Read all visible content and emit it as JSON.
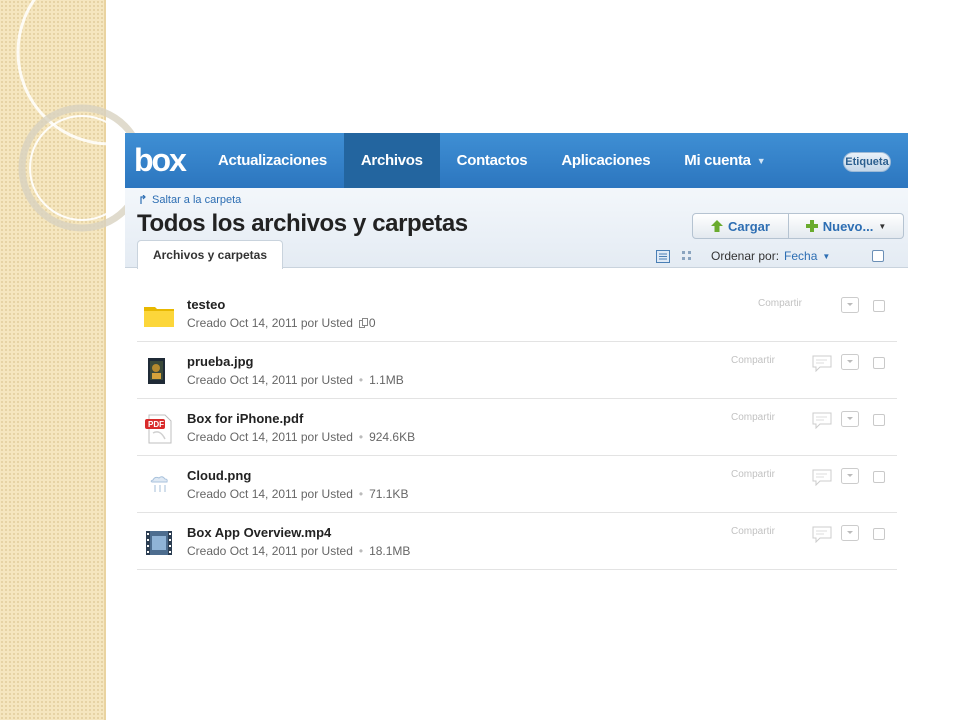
{
  "nav": {
    "logo": "box",
    "items": [
      {
        "label": "Actualizaciones"
      },
      {
        "label": "Archivos"
      },
      {
        "label": "Contactos"
      },
      {
        "label": "Aplicaciones"
      },
      {
        "label": "Mi cuenta"
      }
    ],
    "active_item": "Archivos",
    "tag_label": "Etiqueta"
  },
  "header": {
    "jump_link": "Saltar a la carpeta",
    "title": "Todos los archivos y carpetas",
    "tab_label": "Archivos y carpetas",
    "upload_label": "Cargar",
    "new_label": "Nuevo...",
    "sort_label": "Ordenar por:",
    "sort_value": "Fecha"
  },
  "files": [
    {
      "name": "testeo",
      "created": "Creado Oct 14, 2011 por Usted",
      "size": "",
      "count": "0",
      "share": "Compartir",
      "icon": "folder-icon"
    },
    {
      "name": "prueba.jpg",
      "created": "Creado Oct 14, 2011 por Usted",
      "size": "1.1MB",
      "share": "Compartir",
      "icon": "image-file-icon"
    },
    {
      "name": "Box for iPhone.pdf",
      "created": "Creado Oct 14, 2011 por Usted",
      "size": "924.6KB",
      "share": "Compartir",
      "icon": "pdf-file-icon"
    },
    {
      "name": "Cloud.png",
      "created": "Creado Oct 14, 2011 por Usted",
      "size": "71.1KB",
      "share": "Compartir",
      "icon": "png-file-icon"
    },
    {
      "name": "Box App Overview.mp4",
      "created": "Creado Oct 14, 2011 por Usted",
      "size": "18.1MB",
      "share": "Compartir",
      "icon": "video-file-icon"
    }
  ],
  "colors": {
    "nav_bg": "#3a87cf",
    "nav_active": "#23659f",
    "link": "#2d6eb3",
    "upload_arrow": "#6aab2e"
  }
}
